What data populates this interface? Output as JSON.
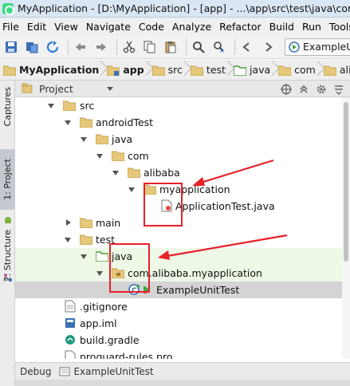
{
  "window": {
    "title": "MyApplication - [D:\\MyApplication] - [app] - ...\\app\\src\\test\\java\\com\\alibaba"
  },
  "menu": [
    "File",
    "Edit",
    "View",
    "Navigate",
    "Code",
    "Analyze",
    "Refactor",
    "Build",
    "Run",
    "Tools"
  ],
  "toolbar": {
    "buttons": [
      "save-all-icon",
      "sync-icon",
      "refresh-icon",
      "back-arrow-icon",
      "forward-arrow-icon",
      "cut-icon",
      "copy-icon",
      "paste-icon",
      "find-icon",
      "replace-icon",
      "back-nav-icon",
      "forward-nav-icon"
    ],
    "run_config": "ExampleU"
  },
  "breadcrumb": [
    "MyApplication",
    "app",
    "src",
    "test",
    "java",
    "com",
    "aliba"
  ],
  "side_tabs": [
    "Captures",
    "1: Project",
    "2: Structure"
  ],
  "panel": {
    "title": "Project"
  },
  "tree": [
    {
      "label": "src",
      "level": 0,
      "expanded": true,
      "icon": "folder-icon"
    },
    {
      "label": "androidTest",
      "level": 1,
      "expanded": true,
      "icon": "folder-icon"
    },
    {
      "label": "java",
      "level": 2,
      "expanded": true,
      "icon": "folder-icon"
    },
    {
      "label": "com",
      "level": 3,
      "expanded": true,
      "icon": "folder-icon"
    },
    {
      "label": "alibaba",
      "level": 4,
      "expanded": true,
      "icon": "folder-icon"
    },
    {
      "label": "myapplication",
      "level": 5,
      "expanded": true,
      "icon": "folder-icon"
    },
    {
      "label": "ApplicationTest.java",
      "level": 6,
      "expanded": null,
      "icon": "java-file-icon"
    },
    {
      "label": "main",
      "level": 1,
      "expanded": false,
      "icon": "folder-icon"
    },
    {
      "label": "test",
      "level": 1,
      "expanded": true,
      "icon": "folder-icon"
    },
    {
      "label": "java",
      "level": 2,
      "expanded": true,
      "icon": "test-source-folder-icon",
      "highlight": true
    },
    {
      "label": "com.alibaba.myapplication",
      "level": 3,
      "expanded": true,
      "icon": "package-icon",
      "highlight": true
    },
    {
      "label": "ExampleUnitTest",
      "level": 4,
      "expanded": null,
      "icon": "test-class-icon",
      "selected": true
    },
    {
      "label": ".gitignore",
      "level": 0,
      "expanded": null,
      "icon": "text-file-icon"
    },
    {
      "label": "app.iml",
      "level": 0,
      "expanded": null,
      "icon": "module-file-icon"
    },
    {
      "label": "build.gradle",
      "level": 0,
      "expanded": null,
      "icon": "gradle-file-icon"
    },
    {
      "label": "proguard-rules.pro",
      "level": 0,
      "expanded": null,
      "icon": "text-file-icon"
    }
  ],
  "debug_bar": {
    "label": "Debug",
    "tab": "ExampleUnitTest"
  },
  "colors": {
    "annotation": "#e8202a",
    "folder": "#e6c87a",
    "test_source": "#4f9a3a",
    "selection": "#d4d4d4",
    "highlight": "#edf8e6"
  }
}
